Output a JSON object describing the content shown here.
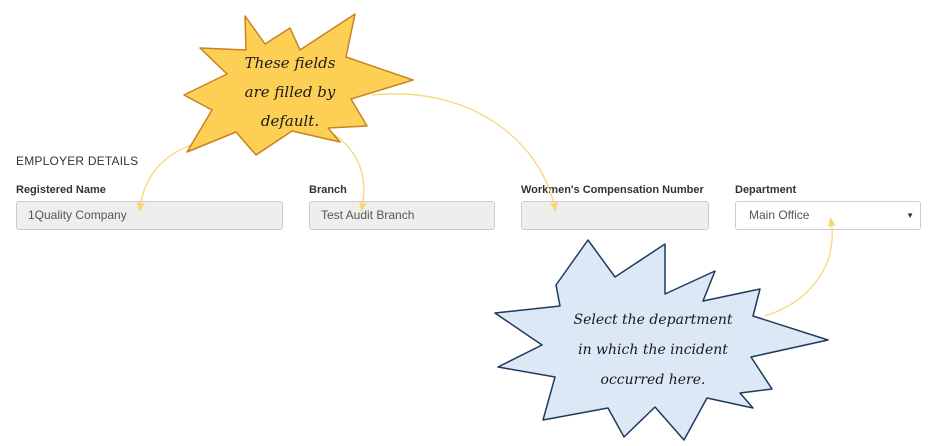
{
  "section": {
    "title": "EMPLOYER DETAILS"
  },
  "fields": {
    "registered_name": {
      "label": "Registered Name",
      "value": "1Quality Company"
    },
    "branch": {
      "label": "Branch",
      "value": "Test Audit Branch"
    },
    "workmens_comp": {
      "label": "Workmen's Compensation Number",
      "value": ""
    },
    "department": {
      "label": "Department",
      "value": "Main Office"
    }
  },
  "callouts": {
    "defaults": "These fields\nare filled by\ndefault.",
    "department": "Select the department\nin which the incident\noccurred here."
  },
  "colors": {
    "starburst_yellow": "#fdd055",
    "starburst_yellow_stroke": "#c9821e",
    "starburst_blue": "#dce8f5",
    "starburst_blue_stroke": "#1f3a5c",
    "arrow": "#f7d774"
  }
}
